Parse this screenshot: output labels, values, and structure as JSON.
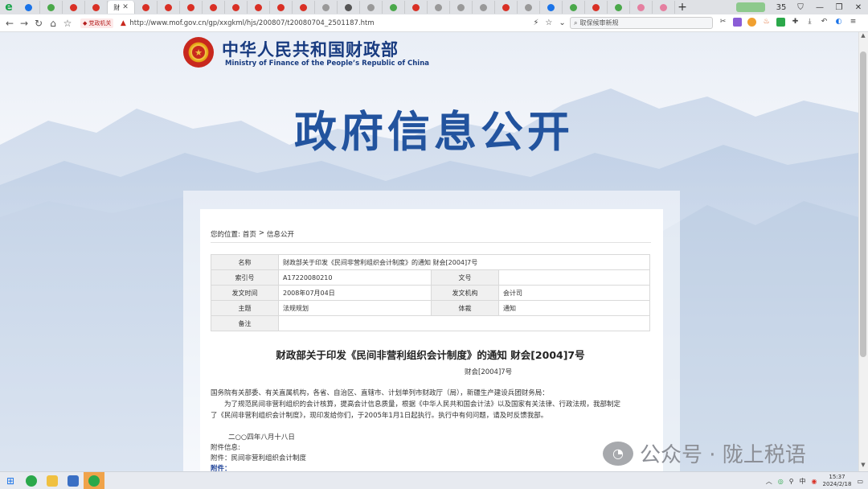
{
  "browser": {
    "logo": "e",
    "active_tab_label": "财",
    "window_badge": "35",
    "url": "http://www.mof.gov.cn/gp/xxgkml/hjs/200807/t20080704_2501187.htm",
    "gov_chip": "党政机关",
    "search_placeholder": "取保候审新规"
  },
  "site": {
    "name_cn": "中华人民共和国财政部",
    "name_en": "Ministry of Finance of the People’s Republic of China",
    "banner": "政府信息公开"
  },
  "breadcrumb": {
    "prefix": "您的位置:",
    "home": "首页",
    "separator": ">",
    "current": "信息公开"
  },
  "meta": {
    "name_label": "名称",
    "name_value": "财政部关于印发《民间非营利组织会计制度》的通知 财会[2004]7号",
    "index_label": "索引号",
    "index_value": "A17220080210",
    "docno_label": "文号",
    "docno_value": "",
    "date_label": "发文时间",
    "date_value": "2008年07月04日",
    "org_label": "发文机构",
    "org_value": "会计司",
    "topic_label": "主题",
    "topic_value": "法规规划",
    "genre_label": "体裁",
    "genre_value": "通知",
    "note_label": "备注",
    "note_value": ""
  },
  "document": {
    "title": "财政部关于印发《民间非营利组织会计制度》的通知 财会[2004]7号",
    "doc_no": "财会[2004]7号",
    "recipients": "国务院有关部委、有关直属机构，各省、自治区、直辖市、计划单列市财政厅（局），新疆生产建设兵团财务局：",
    "body_line1": "为了规范民间非营利组织的会计核算，提高会计信息质量，根据《中华人民共和国会计法》以及国家有关法律、行政法规，我部制定",
    "body_line2": "了《民间非营利组织会计制度》，现印发给你们，于2005年1月1日起执行。执行中有何问题，请及时反馈我部。",
    "date": "二○○四年八月十八日",
    "attachments_label": "附件信息:",
    "attachment_item": "附件：民间非营利组织会计制度",
    "attachment_bold": "附件："
  },
  "watermark": {
    "text": "公众号 · 陇上税语"
  },
  "taskbar": {
    "time": "15:37",
    "date": "2024/2/18",
    "ime": "中"
  }
}
